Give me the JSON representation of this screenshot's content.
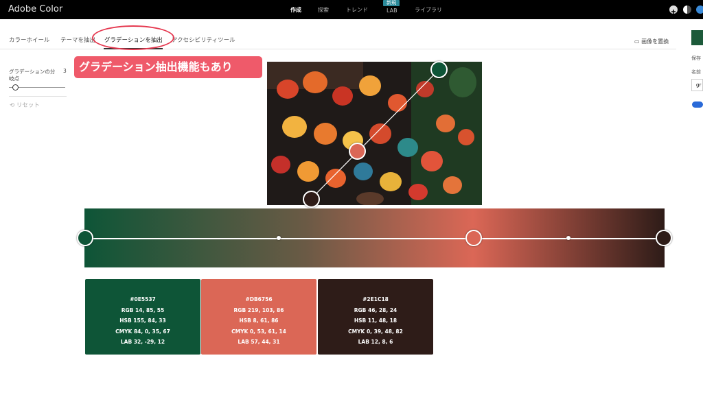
{
  "app": {
    "title": "Adobe Color"
  },
  "topnav": {
    "items": [
      "作成",
      "探索",
      "トレンド",
      "LAB",
      "ライブラリ"
    ],
    "active": "作成",
    "badge": "新規"
  },
  "tabs": [
    "カラーホイール",
    "テーマを抽出",
    "グラデーションを抽出",
    "アクセシビリティツール"
  ],
  "active_tab": "グラデーションを抽出",
  "annotation": {
    "callout": "グラデーション抽出機能もあり"
  },
  "replace_image": "画像を置換",
  "left_panel": {
    "stops_label_1": "グラデーションの分",
    "stops_label_2": "岐点",
    "stops_value": "3",
    "reset": "リセット"
  },
  "gradient": {
    "stops": [
      "#0E5537",
      "#DB6756",
      "#2E1C18"
    ]
  },
  "swatches": [
    {
      "hex": "#0E5537",
      "rgb": "RGB 14, 85, 55",
      "hsb": "HSB 155, 84, 33",
      "cmyk": "CMYK 84, 0, 35, 67",
      "lab": "LAB 32, -29, 12",
      "color": "#0E5537"
    },
    {
      "hex": "#DB6756",
      "rgb": "RGB 219, 103, 86",
      "hsb": "HSB 8, 61, 86",
      "cmyk": "CMYK 0, 53, 61, 14",
      "lab": "LAB 57, 44, 31",
      "color": "#DB6756"
    },
    {
      "hex": "#2E1C18",
      "rgb": "RGB 46, 28, 24",
      "hsb": "HSB 11, 48, 18",
      "cmyk": "CMYK 0, 39, 48, 82",
      "lab": "LAB 12, 8, 6",
      "color": "#2E1C18"
    }
  ],
  "right_panel": {
    "save": "保存",
    "name": "名前",
    "field": "gr"
  }
}
